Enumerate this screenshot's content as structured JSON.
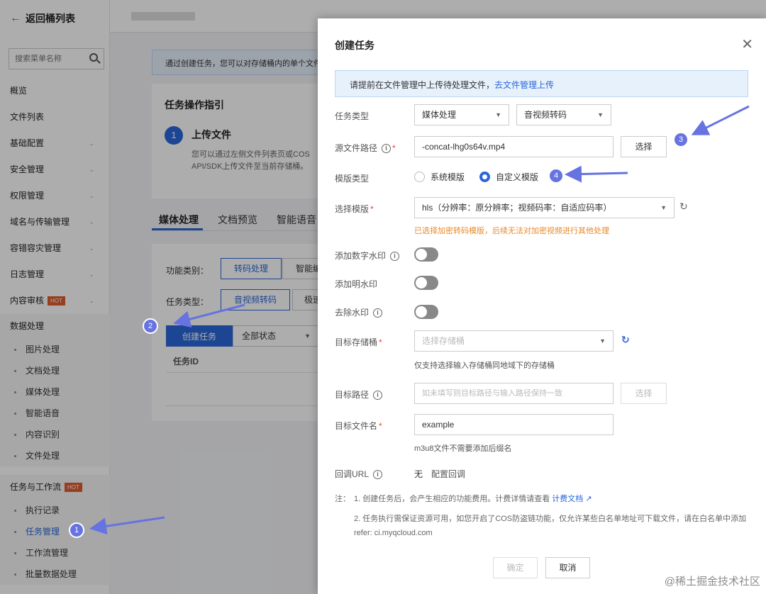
{
  "sidebar": {
    "back_label": "返回桶列表",
    "search_placeholder": "搜索菜单名称",
    "items": [
      {
        "label": "概览",
        "chev": false
      },
      {
        "label": "文件列表",
        "chev": false
      },
      {
        "label": "基础配置",
        "chev": true
      },
      {
        "label": "安全管理",
        "chev": true
      },
      {
        "label": "权限管理",
        "chev": true
      },
      {
        "label": "域名与传输管理",
        "chev": true
      },
      {
        "label": "容错容灾管理",
        "chev": true
      },
      {
        "label": "日志管理",
        "chev": true
      },
      {
        "label": "内容审核",
        "chev": true,
        "hot": "HOT"
      }
    ],
    "data_section": {
      "head": "数据处理",
      "subs": [
        "图片处理",
        "文档处理",
        "媒体处理",
        "智能语音",
        "内容识别",
        "文件处理"
      ]
    },
    "workflow_section": {
      "head": "任务与工作流",
      "hot": "HOT",
      "subs": [
        "执行记录",
        "任务管理",
        "工作流管理",
        "批量数据处理"
      ],
      "active": "任务管理"
    }
  },
  "background": {
    "notice": "通过创建任务，您可以对存储桶内的单个文件",
    "guide_title": "任务操作指引",
    "step_num": "1",
    "step_title": "上传文件",
    "step_desc": "您可以通过左侧文件列表页或COS API/SDK上传文件至当前存储桶。",
    "tabs": [
      "媒体处理",
      "文档预览",
      "智能语音"
    ],
    "func_label": "功能类别：",
    "func_options": [
      "转码处理",
      "智能编"
    ],
    "type_label": "任务类型：",
    "type_options": [
      "音视频转码",
      "极速"
    ],
    "create_button": "创建任务",
    "status_dropdown": "全部状态",
    "col_task_id": "任务ID"
  },
  "modal": {
    "title": "创建任务",
    "tip_text": "请提前在文件管理中上传待处理文件，",
    "tip_link": "去文件管理上传",
    "task_type_label": "任务类型",
    "task_type_value": "媒体处理",
    "task_subtype_value": "音视频转码",
    "source_path_label": "源文件路径",
    "source_path_value": "-concat-lhg0s64v.mp4",
    "select_button": "选择",
    "template_type_label": "模版类型",
    "template_system": "系统模版",
    "template_custom": "自定义模版",
    "choose_template_label": "选择模版",
    "choose_template_value": "hls（分辨率：原分辨率；视频码率：自适应码率）",
    "warning": "已选择加密转码模版，后续无法对加密视频进行其他处理",
    "digital_watermark_label": "添加数字水印",
    "visible_watermark_label": "添加明水印",
    "remove_watermark_label": "去除水印",
    "target_bucket_label": "目标存储桶",
    "target_bucket_placeholder": "选择存储桶",
    "target_bucket_hint": "仅支持选择输入存储桶同地域下的存储桶",
    "target_path_label": "目标路径",
    "target_path_placeholder": "如未填写则目标路径与输入路径保持一致",
    "target_path_button": "选择",
    "target_filename_label": "目标文件名",
    "target_filename_value": "example",
    "target_filename_hint": "m3u8文件不需要添加后缀名",
    "callback_label": "回调URL",
    "callback_value": "无",
    "callback_link": "配置回调",
    "note_prefix": "注：",
    "note1": "1. 创建任务后，会产生相应的功能费用。计费详情请查看",
    "note1_link": "计费文档",
    "note2": "2. 任务执行需保证资源可用，如您开启了COS防盗链功能，仅允许某些白名单地址可下载文件，请在白名单中添加refer: ci.myqcloud.com",
    "confirm_button": "确定",
    "cancel_button": "取消"
  },
  "annotations": [
    "1",
    "2",
    "3",
    "4"
  ],
  "watermark": "@稀土掘金技术社区",
  "colors": {
    "accent": "#2a66d9",
    "annotation": "#6673e0",
    "warning": "#e8892b",
    "hot": "#e15b2b"
  }
}
